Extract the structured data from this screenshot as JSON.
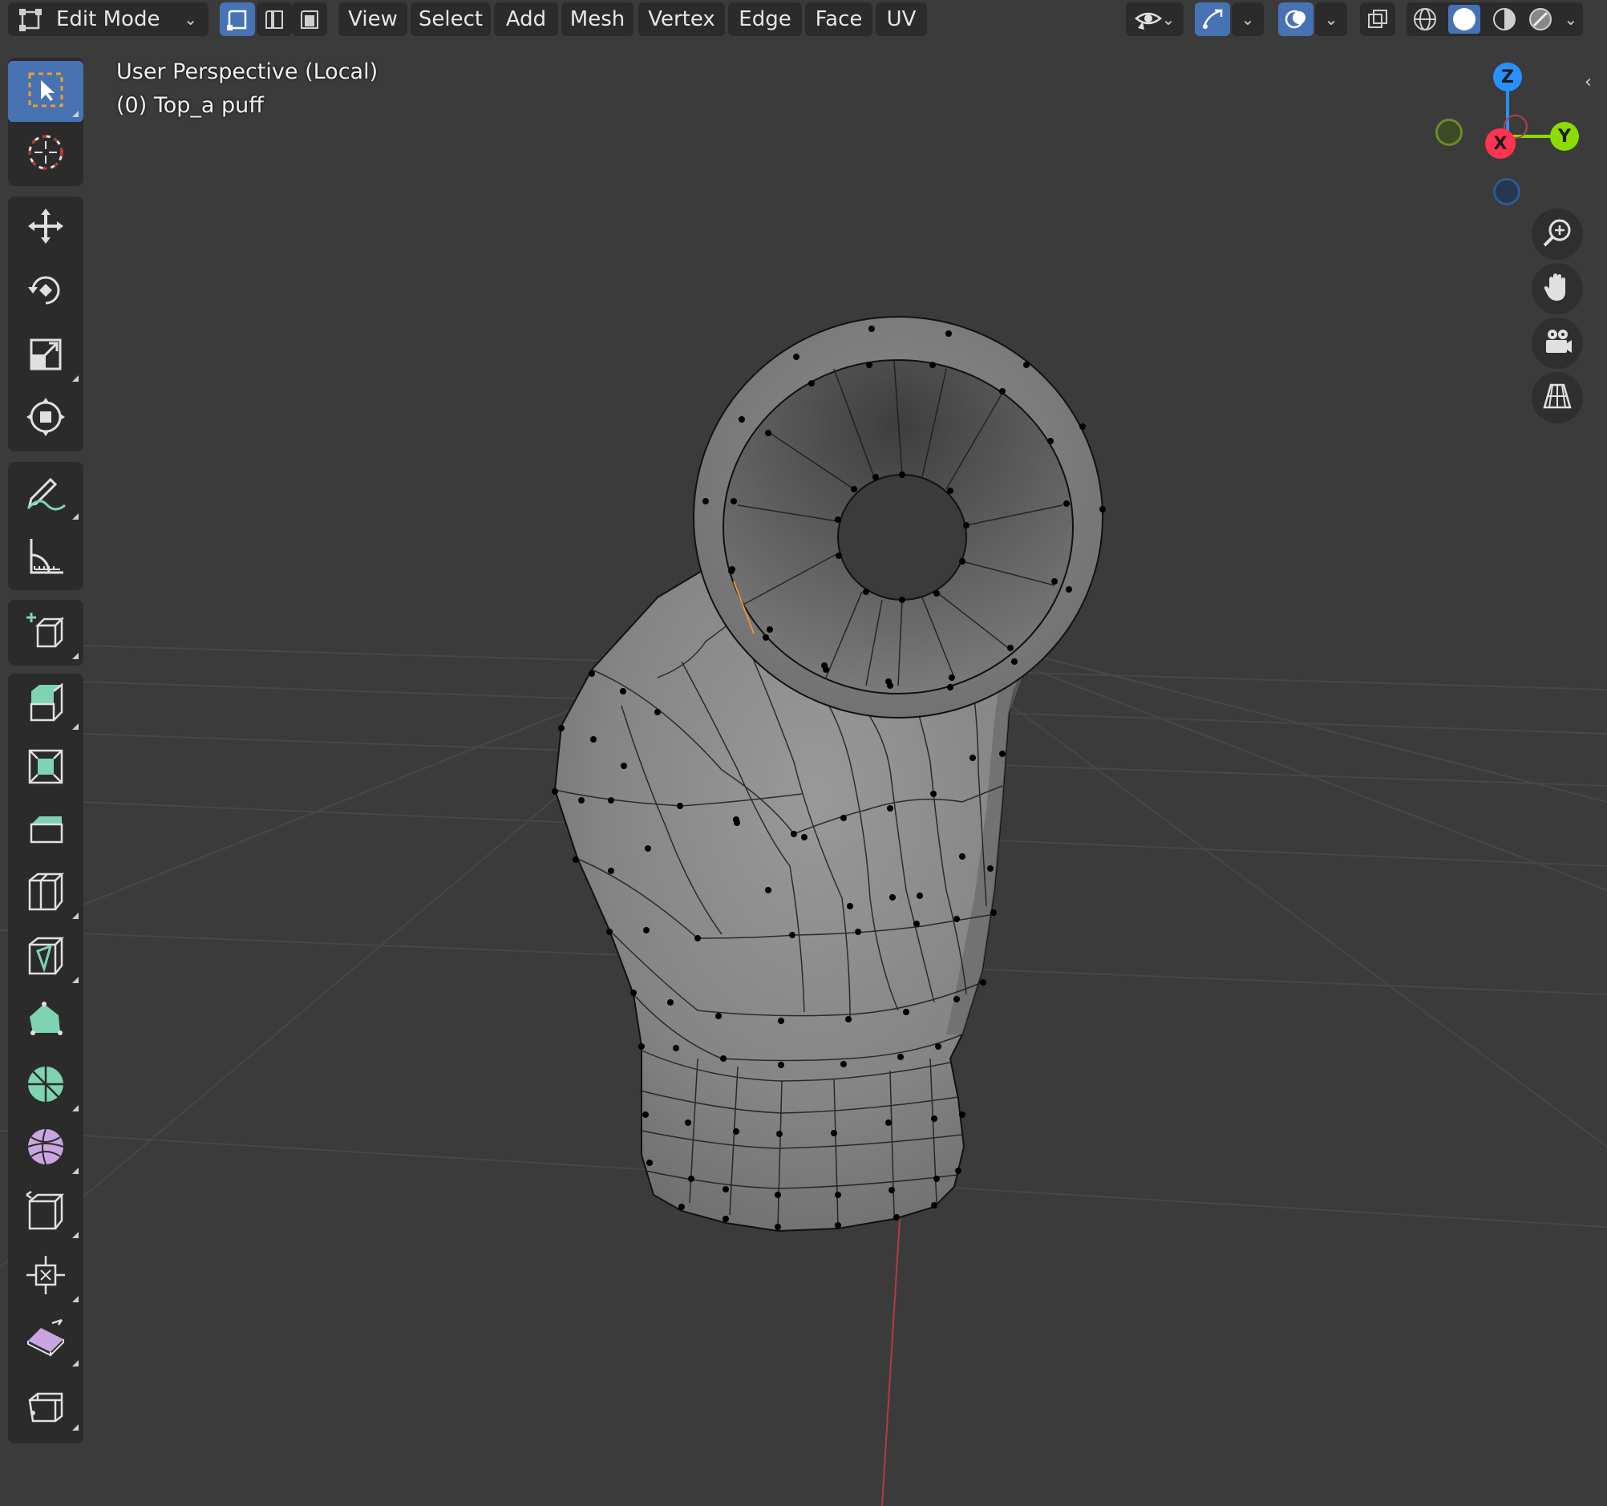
{
  "header": {
    "mode_label": "Edit Mode",
    "menus": [
      "View",
      "Select",
      "Add",
      "Mesh",
      "Vertex",
      "Edge",
      "Face",
      "UV"
    ]
  },
  "overlay": {
    "view_name": "User Perspective (Local)",
    "object_name": "(0) Top_a puff"
  },
  "gizmo": {
    "z_label": "Z",
    "y_label": "Y",
    "x_label": "X"
  },
  "tools": [
    "select-box",
    "cursor",
    "move",
    "rotate",
    "scale",
    "transform",
    "annotate",
    "measure",
    "add-cube",
    "extrude-region",
    "inset-faces",
    "bevel",
    "loop-cut",
    "knife",
    "poly-build",
    "spin",
    "smooth",
    "edge-slide",
    "shrink-fatten",
    "shear",
    "rip-region"
  ],
  "colors": {
    "accent": "#4772b3",
    "viewport_bg": "#3b3b3b",
    "panel_bg": "#2b2b2b",
    "axis_x": "#ff3352",
    "axis_y": "#8bdc00",
    "axis_z": "#2890ff",
    "mesh": "#8a8a8a"
  }
}
